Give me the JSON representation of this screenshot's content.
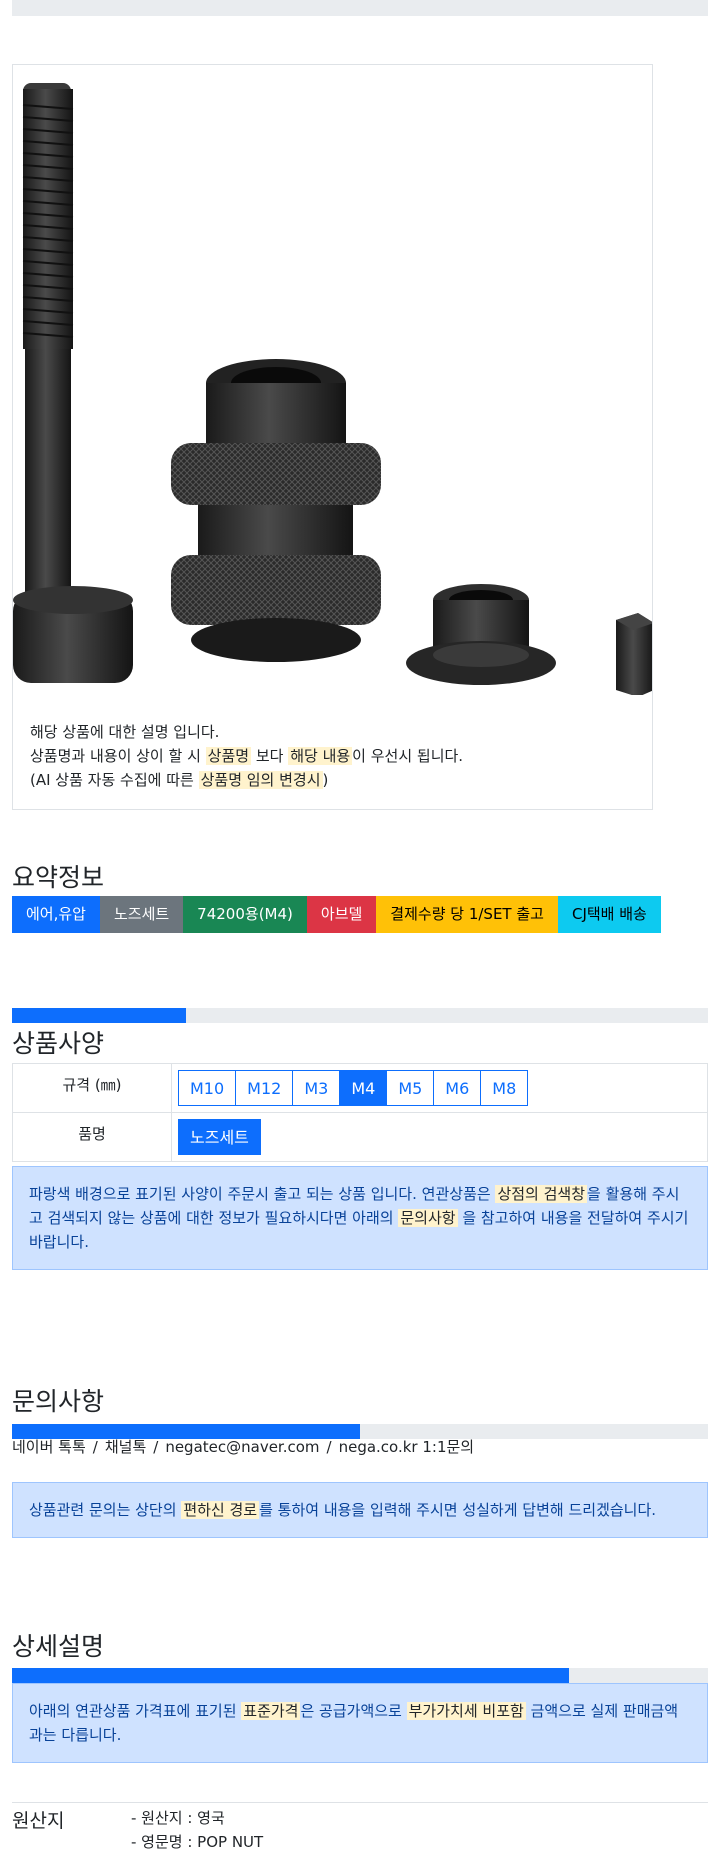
{
  "product": {
    "image_alt": "POP NUT nose set parts",
    "desc_line1": "해당 상품에 대한 설명 입니다.",
    "desc_line2_pre": "상품명과 내용이 상이 할 시 ",
    "desc_line2_hl1": "상품명",
    "desc_line2_mid": " 보다 ",
    "desc_line2_hl2": "해당 내용",
    "desc_line2_post": "이 우선시 됩니다.",
    "desc_line3_pre": "(AI 상품 자동 수집에 따른 ",
    "desc_line3_hl": "상품명 임의 변경시",
    "desc_line3_post": ")"
  },
  "summary": {
    "title": "요약정보",
    "badges": [
      {
        "label": "에어,유압",
        "color": "#0d6efd"
      },
      {
        "label": "노즈세트",
        "color": "#6c757d"
      },
      {
        "label": "74200용(M4)",
        "color": "#198754"
      },
      {
        "label": "아브델",
        "color": "#dc3545"
      },
      {
        "label": "결제수량 당 1/SET 출고",
        "color": "#ffc107"
      },
      {
        "label": "CJ택배 배송",
        "color": "#0dcaf0"
      }
    ]
  },
  "spec": {
    "progress": 0.25,
    "title": "상품사양",
    "row1_label": "규격 (㎜)",
    "sizes": [
      "M10",
      "M12",
      "M3",
      "M4",
      "M5",
      "M6",
      "M8"
    ],
    "selected_size": "M4",
    "row2_label": "품명",
    "name_option": "노즈세트",
    "notice_pre": "파랑색 배경으로 표기된 사양이 주문시 출고 되는 상품 입니다. 연관상품은 ",
    "notice_hl1": "상점의 검색창",
    "notice_mid": "을 활용해 주시고 검색되지 않는 상품에 대한 정보가 필요하시다면 아래의 ",
    "notice_hl2": "문의사항",
    "notice_post": " 을 참고하여 내용을 전달하여 주시기 바랍니다."
  },
  "inquiry": {
    "title": "문의사항",
    "progress": 0.5,
    "contacts": [
      "네이버 톡톡",
      "채널톡",
      "negatec@naver.com",
      "nega.co.kr 1:1문의"
    ],
    "separator": "/",
    "notice_pre": "상품관련 문의는 상단의 ",
    "notice_hl": "편하신 경로",
    "notice_post": "를 통하여 내용을 입력해 주시면 성실하게 답변해 드리겠습니다."
  },
  "detail": {
    "title": "상세설명",
    "progress": 0.8,
    "notice_pre": "아래의 연관상품 가격표에 표기된 ",
    "notice_hl1": "표준가격",
    "notice_mid": "은 공급가액으로 ",
    "notice_hl2": "부가가치세 비포함",
    "notice_post": " 금액으로 실제 판매금액과는 다릅니다."
  },
  "origin": {
    "label": "원산지",
    "items": [
      "- 원산지 : 영국",
      "- 영문명 : POP NUT"
    ]
  }
}
